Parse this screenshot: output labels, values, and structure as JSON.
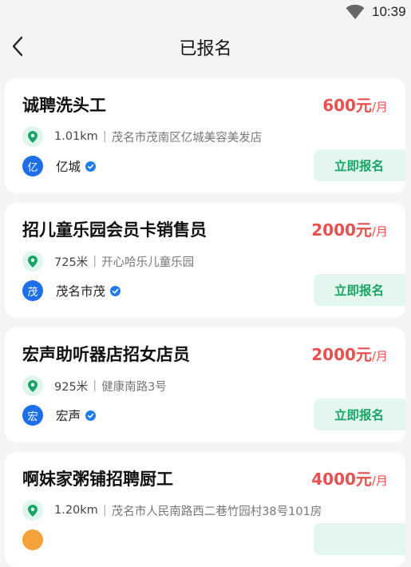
{
  "status_bar": {
    "time": "10:39",
    "wifi_icon": "wifi-icon"
  },
  "nav": {
    "back_icon": "chevron-left-icon",
    "title": "已报名"
  },
  "theme": {
    "salary_color": "#e9514e",
    "accent_green": "#1aa567",
    "avatar_blue": "#1c6fe8"
  },
  "jobs": [
    {
      "title": "诚聘洗头工",
      "salary_amount": "600元",
      "salary_unit": "/月",
      "distance": "1.01km",
      "separator": "|",
      "address": "茂名市茂南区亿城美容美发店",
      "avatar_char": "亿",
      "company": "亿城",
      "apply_label": "立即报名"
    },
    {
      "title": "招儿童乐园会员卡销售员",
      "salary_amount": "2000元",
      "salary_unit": "/月",
      "distance": "725米",
      "separator": "|",
      "address": "开心哈乐儿童乐园",
      "avatar_char": "茂",
      "company": "茂名市茂",
      "apply_label": "立即报名"
    },
    {
      "title": "宏声助听器店招女店员",
      "salary_amount": "2000元",
      "salary_unit": "/月",
      "distance": "925米",
      "separator": "|",
      "address": "健康南路3号",
      "avatar_char": "宏",
      "company": "宏声",
      "apply_label": "立即报名"
    },
    {
      "title": "啊妹家粥铺招聘厨工",
      "salary_amount": "4000元",
      "salary_unit": "/月",
      "distance": "1.20km",
      "separator": "|",
      "address": "茂名市人民南路西二巷竹园村38号101房",
      "avatar_char": "",
      "company": "",
      "apply_label": ""
    }
  ]
}
